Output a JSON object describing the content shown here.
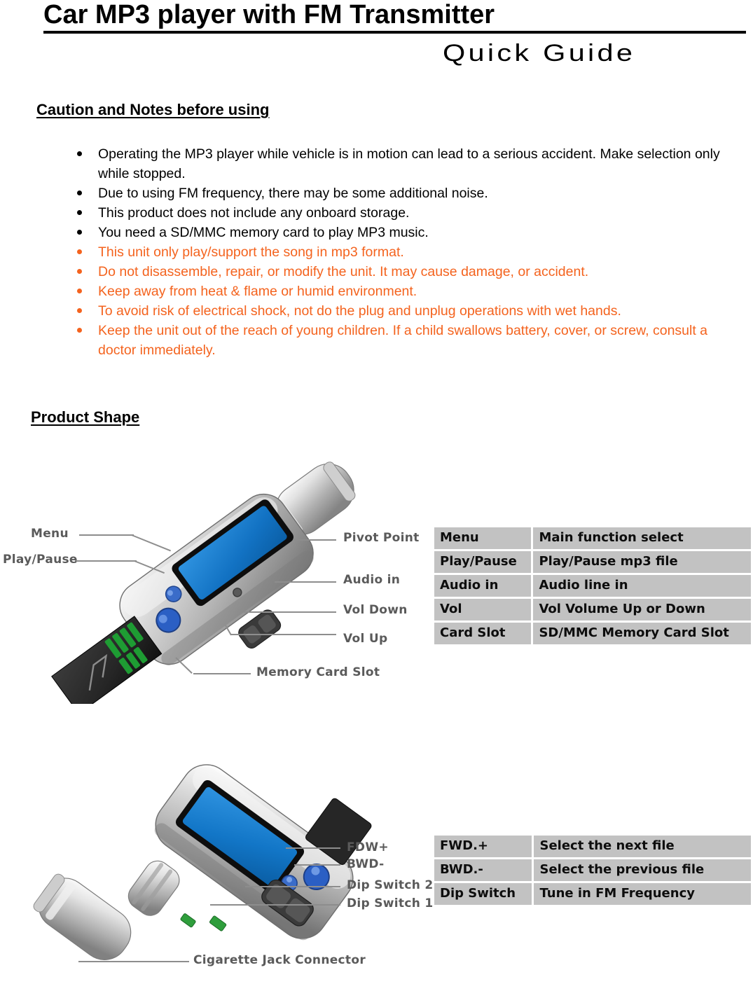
{
  "header": {
    "title": "Car MP3 player with FM Transmitter",
    "subtitle": "Quick Guide"
  },
  "sections": {
    "caution_heading": "Caution and Notes before using",
    "product_heading": "Product Shape"
  },
  "colors": {
    "warning_text": "#F4631E",
    "table_cell_bg": "#C2C2C2",
    "callout_text": "#5A5A5A",
    "lcd_blue": "#1B7FD4",
    "sd_card_body": "#2B2B2B",
    "sd_card_contacts": "#1E9C33"
  },
  "caution_items": [
    {
      "text": "Operating the MP3 player while vehicle is in motion can lead to a serious accident. Make selection only while stopped.",
      "warn": false
    },
    {
      "text": "Due to using FM frequency, there may be some additional noise.",
      "warn": false
    },
    {
      "text": "This product does not include any onboard storage.",
      "warn": false
    },
    {
      "text": "You need a SD/MMC memory card to play MP3 music.",
      "warn": false
    },
    {
      "text": "This unit only play/support the song in mp3 format.",
      "warn": true
    },
    {
      "text": "Do not disassemble, repair, or modify the unit. It may cause damage, or accident.",
      "warn": true
    },
    {
      "text": "Keep away from heat & flame or humid environment.",
      "warn": true
    },
    {
      "text": "To avoid risk of electrical shock, not do the plug and unplug operations with wet hands.",
      "warn": true
    },
    {
      "text": "Keep the unit out of the reach of young children. If a child swallows battery, cover, or screw, consult a doctor immediately.",
      "warn": true
    }
  ],
  "diagram_top": {
    "callouts": [
      {
        "name": "menu",
        "label": "Menu"
      },
      {
        "name": "play-pause",
        "label": "Play/Pause"
      },
      {
        "name": "pivot-point",
        "label": "Pivot Point"
      },
      {
        "name": "audio-in",
        "label": "Audio in"
      },
      {
        "name": "vol-down",
        "label": "Vol Down"
      },
      {
        "name": "vol-up",
        "label": "Vol Up"
      },
      {
        "name": "memory-card-slot",
        "label": "Memory Card Slot"
      }
    ]
  },
  "diagram_bottom": {
    "callouts": [
      {
        "name": "fdw-plus",
        "label": "FDW+"
      },
      {
        "name": "bwd-minus",
        "label": "BWD-"
      },
      {
        "name": "dip-switch-2",
        "label": "Dip Switch 2"
      },
      {
        "name": "dip-switch-1",
        "label": "Dip Switch 1"
      },
      {
        "name": "cigarette-jack-connector",
        "label": "Cigarette Jack Connector"
      }
    ]
  },
  "table_top": {
    "rows": [
      {
        "key": "Menu",
        "value": "Main function select"
      },
      {
        "key": "Play/Pause",
        "value": "Play/Pause mp3 file"
      },
      {
        "key": "Audio in",
        "value": "Audio line in"
      },
      {
        "key": "Vol",
        "value": "Vol Volume Up or Down"
      },
      {
        "key": "Card Slot",
        "value": "SD/MMC Memory Card Slot"
      }
    ]
  },
  "table_bottom": {
    "rows": [
      {
        "key": "FWD.+",
        "value": "Select the next file"
      },
      {
        "key": "BWD.-",
        "value": "Select the previous file"
      },
      {
        "key": "Dip Switch",
        "value": "Tune in FM Frequency"
      }
    ]
  }
}
